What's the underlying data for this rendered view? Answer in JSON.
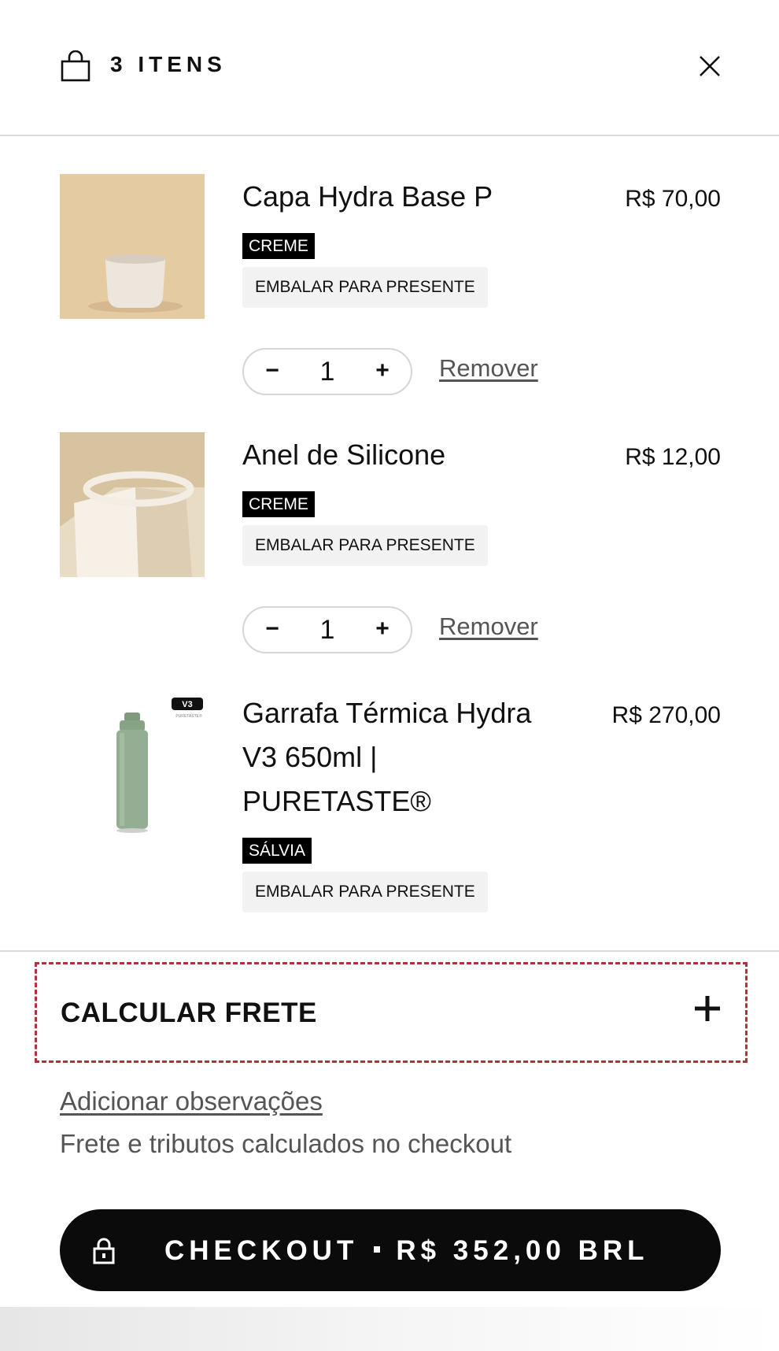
{
  "header": {
    "items_count": "3 ITENS",
    "bag_icon": "shopping-bag-icon",
    "close_icon": "close-icon"
  },
  "cart": {
    "items": [
      {
        "title": "Capa Hydra Base P",
        "price": "R$ 70,00",
        "variant": "CREME",
        "gift_option": "EMBALAR PARA PRESENTE",
        "quantity": "1",
        "remove_label": "Remover"
      },
      {
        "title": "Anel de Silicone",
        "price": "R$ 12,00",
        "variant": "CREME",
        "gift_option": "EMBALAR PARA PRESENTE",
        "quantity": "1",
        "remove_label": "Remover"
      },
      {
        "title": "Garrafa Térmica Hydra V3 650ml | PURETASTE®",
        "price": "R$ 270,00",
        "variant": "SÁLVIA",
        "gift_option": "EMBALAR PARA PRESENTE",
        "badge": "V3",
        "badge_sub": "PURETASTE®"
      }
    ],
    "qty_minus": "−",
    "qty_plus": "+"
  },
  "footer": {
    "freight_label": "CALCULAR FRETE",
    "notes_link": "Adicionar observações",
    "tax_note": "Frete e tributos calculados no checkout",
    "checkout_label": "CHECKOUT",
    "checkout_total": "R$ 352,00 BRL",
    "lock_icon": "lock-icon"
  },
  "colors": {
    "accent_dashed_border": "#b0323a",
    "button_bg": "#0b0b0b",
    "variant_bg": "#000000",
    "gift_bg": "#f2f2f2"
  }
}
